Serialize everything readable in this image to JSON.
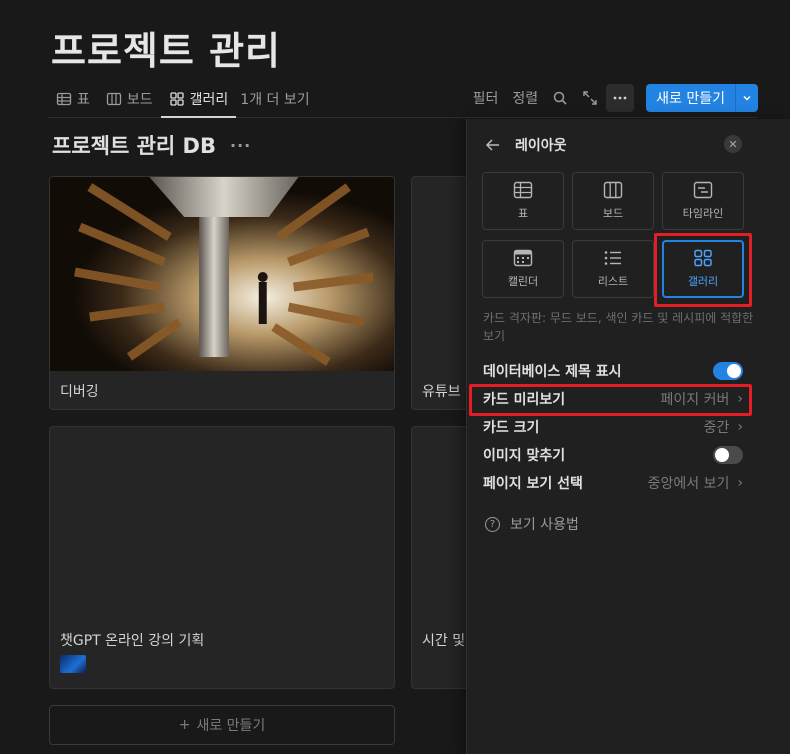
{
  "page": {
    "title": "프로젝트 관리"
  },
  "viewbar": {
    "tabs": [
      {
        "label": "표",
        "icon": "table-icon"
      },
      {
        "label": "보드",
        "icon": "board-icon"
      },
      {
        "label": "갤러리",
        "icon": "gallery-icon",
        "active": true
      }
    ],
    "more_views": "1개 더 보기",
    "filter": "필터",
    "sort": "정렬",
    "new_label": "새로 만들기"
  },
  "database": {
    "title": "프로젝트 관리 DB",
    "more": "···"
  },
  "cards": [
    {
      "title": "디버깅",
      "has_cover": true
    },
    {
      "title": "유튜브"
    },
    {
      "title": "챗GPT 온라인 강의 기획",
      "has_thumb": true
    },
    {
      "title": "시간 및"
    }
  ],
  "add_row": {
    "label": "새로 만들기",
    "icon": "+"
  },
  "panel": {
    "title": "레이아웃",
    "layouts": [
      {
        "label": "표",
        "icon": "table-icon"
      },
      {
        "label": "보드",
        "icon": "board-icon"
      },
      {
        "label": "타임라인",
        "icon": "timeline-icon"
      },
      {
        "label": "캘린더",
        "icon": "calendar-icon"
      },
      {
        "label": "리스트",
        "icon": "list-icon"
      },
      {
        "label": "갤러리",
        "icon": "gallery-icon",
        "selected": true
      }
    ],
    "description": "카드 격자판: 무드 보드, 색인 카드 및 레시피에 적합한 보기",
    "options": {
      "show_db_title": {
        "label": "데이터베이스 제목 표시",
        "enabled": true
      },
      "card_preview": {
        "label": "카드 미리보기",
        "value": "페이지 커버"
      },
      "card_size": {
        "label": "카드 크기",
        "value": "중간"
      },
      "fit_image": {
        "label": "이미지 맞추기",
        "enabled": false
      },
      "open_pages_in": {
        "label": "페이지 보기 선택",
        "value": "중앙에서 보기"
      }
    },
    "help": "보기 사용법"
  },
  "colors": {
    "accent": "#2383e2",
    "highlight": "#e31e24",
    "background": "#191919"
  }
}
